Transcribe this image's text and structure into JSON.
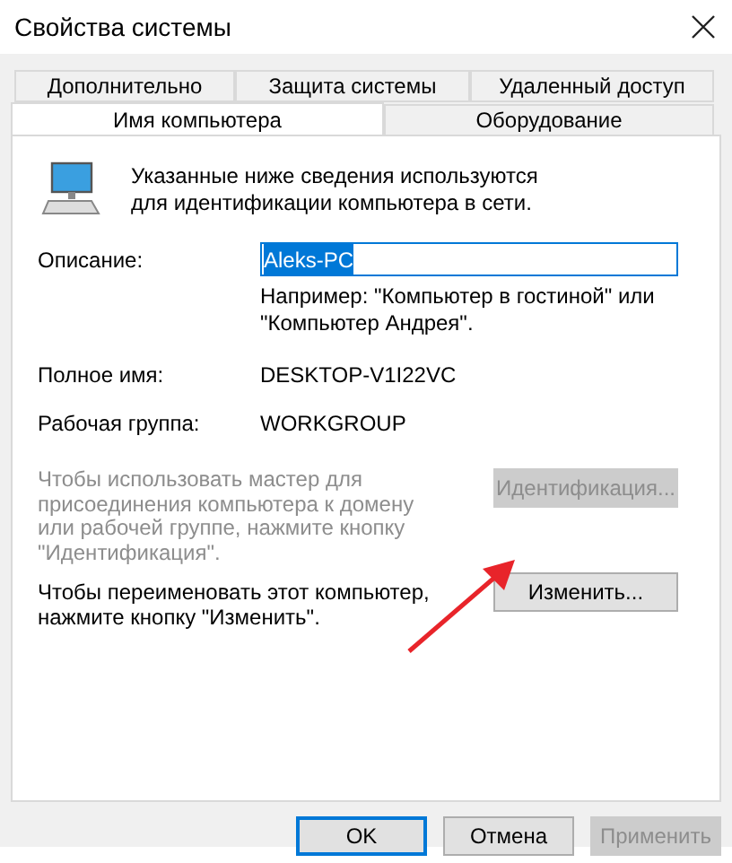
{
  "window": {
    "title": "Свойства системы"
  },
  "tab_rows": [
    [
      {
        "label": "Дополнительно",
        "selected": false
      },
      {
        "label": "Защита системы",
        "selected": false
      },
      {
        "label": "Удаленный доступ",
        "selected": false
      }
    ],
    [
      {
        "label": "Имя компьютера",
        "selected": true
      },
      {
        "label": "Оборудование",
        "selected": false
      }
    ]
  ],
  "intro": "Указанные ниже сведения используются для идентификации компьютера в сети.",
  "description": {
    "label": "Описание:",
    "value": "Aleks-PC",
    "hint": "Например: \"Компьютер в гостиной\" или \"Компьютер Андрея\"."
  },
  "fields": [
    {
      "label": "Полное имя:",
      "value": "DESKTOP-V1I22VC"
    },
    {
      "label": "Рабочая группа:",
      "value": "WORKGROUP"
    }
  ],
  "actions": [
    {
      "text": "Чтобы использовать мастер для присоединения компьютера к домену или рабочей группе, нажмите кнопку \"Идентификация\".",
      "button": "Идентификация...",
      "disabled": true
    },
    {
      "text": "Чтобы переименовать этот компьютер, нажмите кнопку \"Изменить\".",
      "button": "Изменить...",
      "disabled": false
    }
  ],
  "buttons": [
    {
      "label": "OK",
      "default": true,
      "disabled": false
    },
    {
      "label": "Отмена",
      "default": false,
      "disabled": false
    },
    {
      "label": "Применить",
      "default": false,
      "disabled": true
    }
  ]
}
